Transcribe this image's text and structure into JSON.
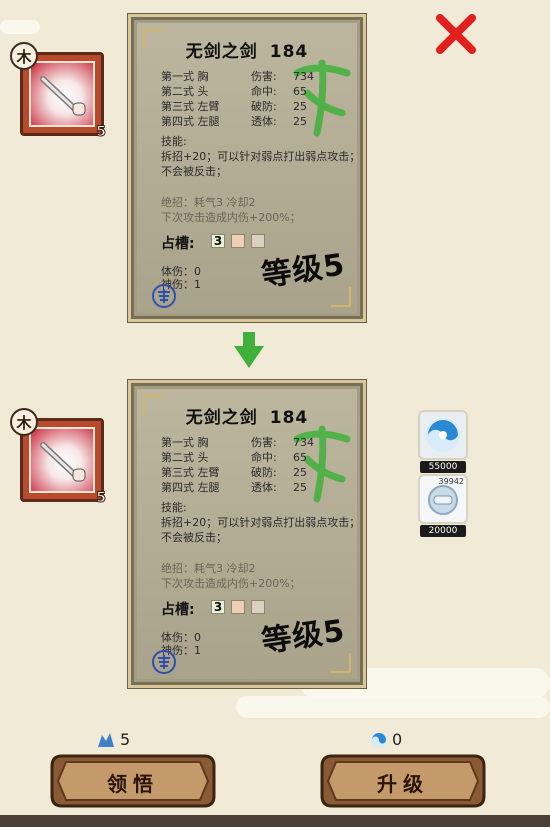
{
  "current_card": {
    "title": "无剑之剑",
    "power": "184",
    "stats": [
      {
        "pos": "第一式 胸",
        "key": "伤害:",
        "val": "734"
      },
      {
        "pos": "第二式 头",
        "key": "命中:",
        "val": "65"
      },
      {
        "pos": "第三式 左臂",
        "key": "破防:",
        "val": "25"
      },
      {
        "pos": "第四式 左腿",
        "key": "透体:",
        "val": "25"
      }
    ],
    "skill_header": "技能:",
    "skill_desc": "拆招+20；可以针对弱点打出弱点攻击；不会被反击；",
    "ult_line1": "绝招：耗气3 冷却2",
    "ult_line2": "下次攻击造成内伤+200%；",
    "slot_label": "占槽:",
    "slot_value": "3",
    "body_dmg": "体伤：0",
    "spirit_dmg": "神伤：1",
    "level_text": "等级5"
  },
  "next_card": {
    "title": "无剑之剑",
    "power": "184",
    "stats": [
      {
        "pos": "第一式 胸",
        "key": "伤害:",
        "val": "734"
      },
      {
        "pos": "第二式 头",
        "key": "命中:",
        "val": "65"
      },
      {
        "pos": "第三式 左臂",
        "key": "破防:",
        "val": "25"
      },
      {
        "pos": "第四式 左腿",
        "key": "透体:",
        "val": "25"
      }
    ],
    "skill_header": "技能:",
    "skill_desc": "拆招+20；可以针对弱点打出弱点攻击；不会被反击；",
    "ult_line1": "绝招：耗气3 冷却2",
    "ult_line2": "下次攻击造成内伤+200%；",
    "slot_label": "占槽:",
    "slot_value": "3",
    "body_dmg": "体伤：0",
    "spirit_dmg": "神伤：1",
    "level_text": "等级5"
  },
  "badge_top": {
    "element": "木",
    "level": "5"
  },
  "badge_bottom": {
    "element": "木",
    "level": "5"
  },
  "shop": [
    {
      "price": "55000",
      "icon": "swirl-orb-icon"
    },
    {
      "price": "20000",
      "icon": "scroll-orb-icon",
      "count": "39942"
    }
  ],
  "resources": {
    "crystal_count": "5",
    "orb_count": "0"
  },
  "buttons": {
    "comprehend": "领悟",
    "upgrade": "升级"
  },
  "colors": {
    "accent_green": "#3fb03a",
    "close_red": "#e11f1f",
    "button_brown": "#8a5a34"
  }
}
